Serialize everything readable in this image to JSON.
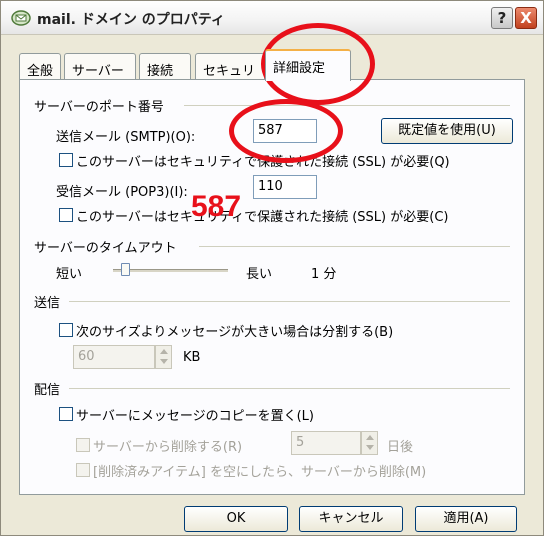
{
  "window": {
    "title": "mail. ドメイン のプロパティ",
    "help_label": "?",
    "close_label": "X"
  },
  "tabs": [
    {
      "label": "全般"
    },
    {
      "label": "サーバー"
    },
    {
      "label": "接続"
    },
    {
      "label": "セキュリティ"
    },
    {
      "label": "詳細設定",
      "active": true
    }
  ],
  "ports": {
    "heading": "サーバーのポート番号",
    "smtp_label": "送信メール (SMTP)(O):",
    "smtp_value": "587",
    "default_button": "既定値を使用(U)",
    "smtp_ssl_label": "このサーバーはセキュリティで保護された接続 (SSL) が必要(Q)",
    "pop3_label": "受信メール (POP3)(I):",
    "pop3_value": "110",
    "pop3_ssl_label": "このサーバーはセキュリティで保護された接続 (SSL) が必要(C)"
  },
  "timeout": {
    "heading": "サーバーのタイムアウト",
    "short_label": "短い",
    "long_label": "長い",
    "value_text": "1 分",
    "level": 0.08
  },
  "sending": {
    "heading": "送信",
    "split_label": "次のサイズよりメッセージが大きい場合は分割する(B)",
    "size_value": "60",
    "size_unit": "KB"
  },
  "delivery": {
    "heading": "配信",
    "leave_copy_label": "サーバーにメッセージのコピーを置く(L)",
    "remove_after_label": "サーバーから削除する(R)",
    "days_value": "5",
    "days_unit": "日後",
    "remove_deleted_label": "[削除済みアイテム] を空にしたら、サーバーから削除(M)"
  },
  "buttons": {
    "ok": "OK",
    "cancel": "キャンセル",
    "apply": "適用(A)"
  },
  "annotation": {
    "callout_text": "587",
    "highlight_color": "#e8101a"
  }
}
